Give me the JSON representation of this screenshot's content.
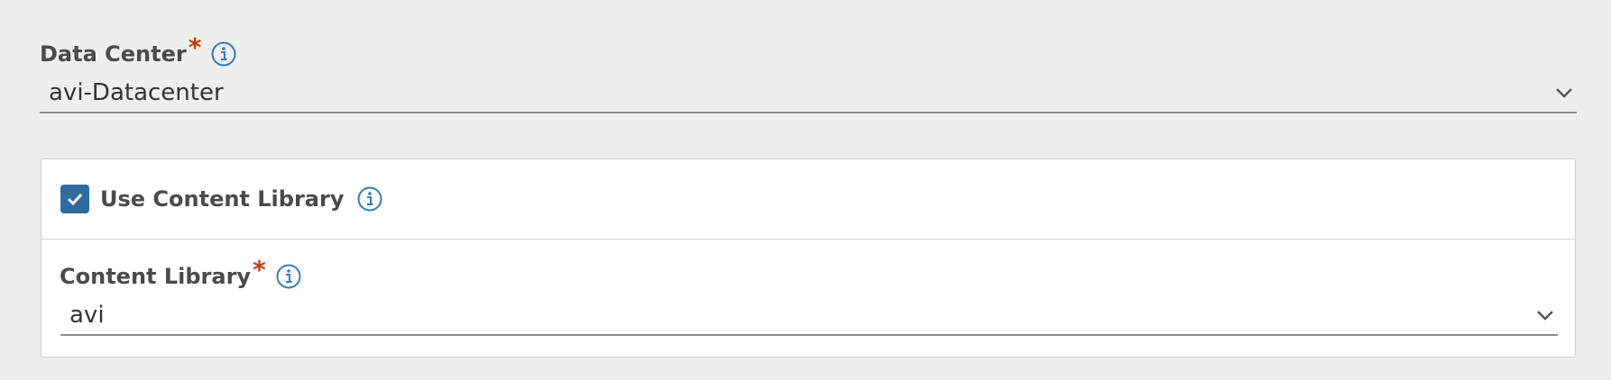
{
  "data_center": {
    "label": "Data Center",
    "required_mark": "*",
    "selected_value": "avi-Datacenter",
    "info_icon": "info-circle-icon",
    "dropdown_icon": "chevron-down-icon"
  },
  "content_library_section": {
    "use_content_library": {
      "label": "Use Content Library",
      "checked": true,
      "info_icon": "info-circle-icon"
    },
    "content_library": {
      "label": "Content Library",
      "required_mark": "*",
      "selected_value": "avi",
      "info_icon": "info-circle-icon",
      "dropdown_icon": "chevron-down-icon"
    }
  },
  "colors": {
    "background": "#eeeeee",
    "required": "#c2410c",
    "info_icon": "#2f7bbf",
    "checkbox": "#2e6b9f"
  }
}
